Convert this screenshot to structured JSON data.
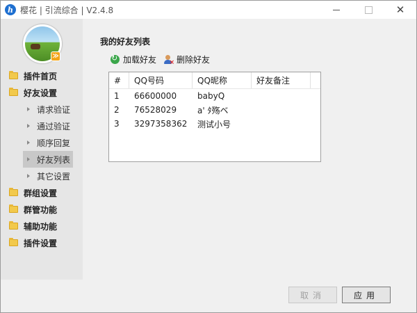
{
  "window": {
    "title": "樱花 | 引流综合 | V2.4.8"
  },
  "sidebar": {
    "items": [
      {
        "label": "插件首页",
        "level": "top",
        "icon": "folder-icon"
      },
      {
        "label": "好友设置",
        "level": "top",
        "icon": "folder-icon"
      },
      {
        "label": "请求验证",
        "level": "sub",
        "icon": "triangle-icon"
      },
      {
        "label": "通过验证",
        "level": "sub",
        "icon": "triangle-icon"
      },
      {
        "label": "顺序回复",
        "level": "sub",
        "icon": "triangle-icon"
      },
      {
        "label": "好友列表",
        "level": "sub",
        "icon": "triangle-icon",
        "active": true
      },
      {
        "label": "其它设置",
        "level": "sub",
        "icon": "triangle-icon"
      },
      {
        "label": "群组设置",
        "level": "top",
        "icon": "folder-icon"
      },
      {
        "label": "群管功能",
        "level": "top",
        "icon": "folder-icon"
      },
      {
        "label": "辅助功能",
        "level": "top",
        "icon": "folder-icon"
      },
      {
        "label": "插件设置",
        "level": "top",
        "icon": "folder-icon"
      }
    ]
  },
  "main": {
    "title": "我的好友列表",
    "toolbar": {
      "load_label": "加载好友",
      "delete_label": "删除好友"
    },
    "table": {
      "headers": [
        "#",
        "QQ号码",
        "QQ昵称",
        "好友备注"
      ],
      "rows": [
        [
          "1",
          "66600000",
          "babyQ",
          ""
        ],
        [
          "2",
          "76528029",
          "a' ﾀ殇ベ",
          ""
        ],
        [
          "3",
          "3297358362",
          "测试小号",
          ""
        ]
      ]
    }
  },
  "footer": {
    "cancel_label": "取消",
    "apply_label": "应用"
  }
}
